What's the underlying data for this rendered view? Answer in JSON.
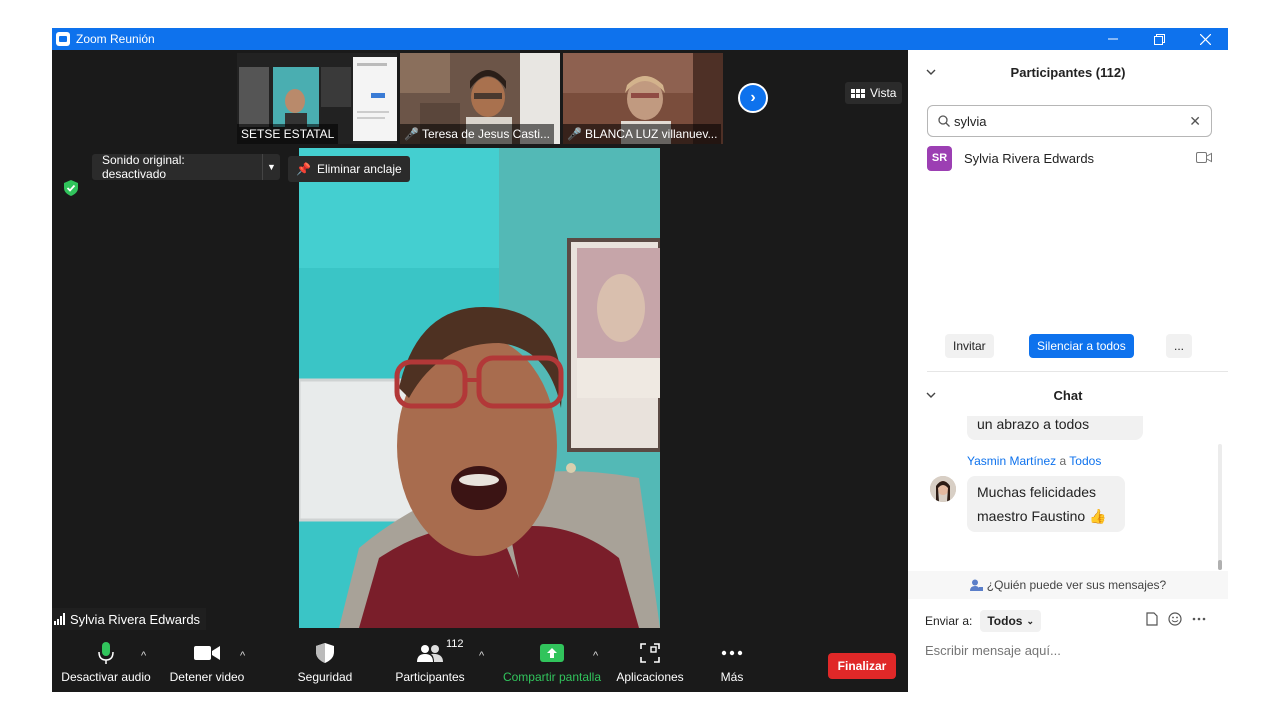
{
  "window": {
    "title": "Zoom Reunión",
    "controls": [
      "minimize-icon",
      "restore-icon",
      "close-icon"
    ]
  },
  "thumbnails": [
    {
      "name": "SETSE ESTATAL",
      "muted": false
    },
    {
      "name": "Teresa de Jesus Casti...",
      "muted": true
    },
    {
      "name": "BLANCA LUZ villanuev...",
      "muted": true
    }
  ],
  "view_button": {
    "label": "Vista",
    "icon": "grid-icon"
  },
  "sound": {
    "label": "Sonido original: desactivado"
  },
  "unpin": {
    "label": "Eliminar anclaje"
  },
  "speaker": {
    "name": "Sylvia Rivera Edwards"
  },
  "toolbar": {
    "mute_label": "Desactivar audio",
    "video_label": "Detener video",
    "security_label": "Seguridad",
    "participants_label": "Participantes",
    "participants_count": "112",
    "share_label": "Compartir pantalla",
    "apps_label": "Aplicaciones",
    "more_label": "Más",
    "end_label": "Finalizar",
    "share_color": "#31c45c",
    "end_color": "#e02828"
  },
  "participants_panel": {
    "title": "Participantes (112)",
    "search_value": "sylvia",
    "results": [
      {
        "initials": "SR",
        "name": "Sylvia Rivera Edwards",
        "avatar_color": "#9c3fb3"
      }
    ],
    "invite_label": "Invitar",
    "mute_all_label": "Silenciar a todos",
    "more_label": "..."
  },
  "chat": {
    "title": "Chat",
    "messages": [
      {
        "sender": "",
        "to": "",
        "text": "un abrazo a todos"
      },
      {
        "sender": "Yasmin Martínez",
        "connector": "a",
        "to": "Todos",
        "text_line1": "Muchas felicidades",
        "text_line2": "maestro Faustino",
        "emoji": "👍"
      }
    ],
    "who_can_see": "¿Quién puede ver sus mensajes?",
    "send_to_label": "Enviar a:",
    "send_to_value": "Todos",
    "input_placeholder": "Escribir mensaje aquí..."
  },
  "accent_color": "#0e72ed"
}
